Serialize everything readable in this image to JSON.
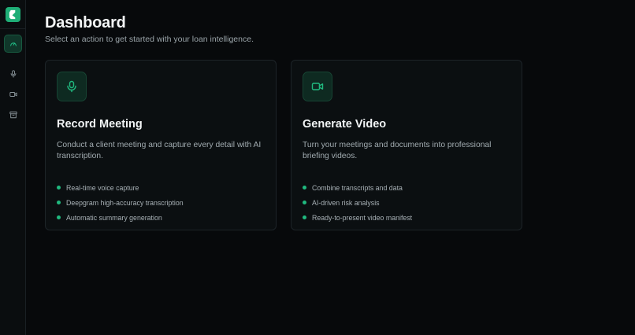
{
  "colors": {
    "accent": "#20b97f",
    "background": "#07090b",
    "card_background": "#0b0f11",
    "card_border": "#1d2428"
  },
  "sidebar": {
    "logo_icon": "brand-logo-icon",
    "items": [
      {
        "id": "dashboard",
        "icon": "gauge-icon",
        "active": true
      },
      {
        "id": "record",
        "icon": "microphone-icon",
        "active": false
      },
      {
        "id": "video",
        "icon": "video-camera-icon",
        "active": false
      },
      {
        "id": "archive",
        "icon": "archive-icon",
        "active": false
      }
    ]
  },
  "header": {
    "title": "Dashboard",
    "subtitle": "Select an action to get started with your loan intelligence."
  },
  "cards": [
    {
      "icon": "microphone-icon",
      "title": "Record Meeting",
      "description": "Conduct a client meeting and capture every detail with AI transcription.",
      "features": [
        "Real-time voice capture",
        "Deepgram high-accuracy transcription",
        "Automatic summary generation"
      ]
    },
    {
      "icon": "video-camera-icon",
      "title": "Generate Video",
      "description": "Turn your meetings and documents into professional briefing videos.",
      "features": [
        "Combine transcripts and data",
        "AI-driven risk analysis",
        "Ready-to-present video manifest"
      ]
    }
  ]
}
